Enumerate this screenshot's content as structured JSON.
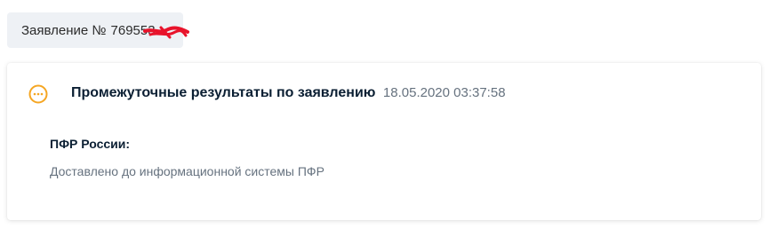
{
  "application_tag": {
    "label": "Заявление №",
    "number": "769553…"
  },
  "card": {
    "title": "Промежуточные результаты по заявлению",
    "datetime": "18.05.2020 03:37:58",
    "status_icon": "more-dots-icon",
    "accent_color": "#f5a623",
    "section": {
      "label": "ПФР России:",
      "text": "Доставлено до информационной системы ПФР"
    }
  },
  "colors": {
    "tag_background": "#eef1f5",
    "redaction": "#e8132b"
  }
}
